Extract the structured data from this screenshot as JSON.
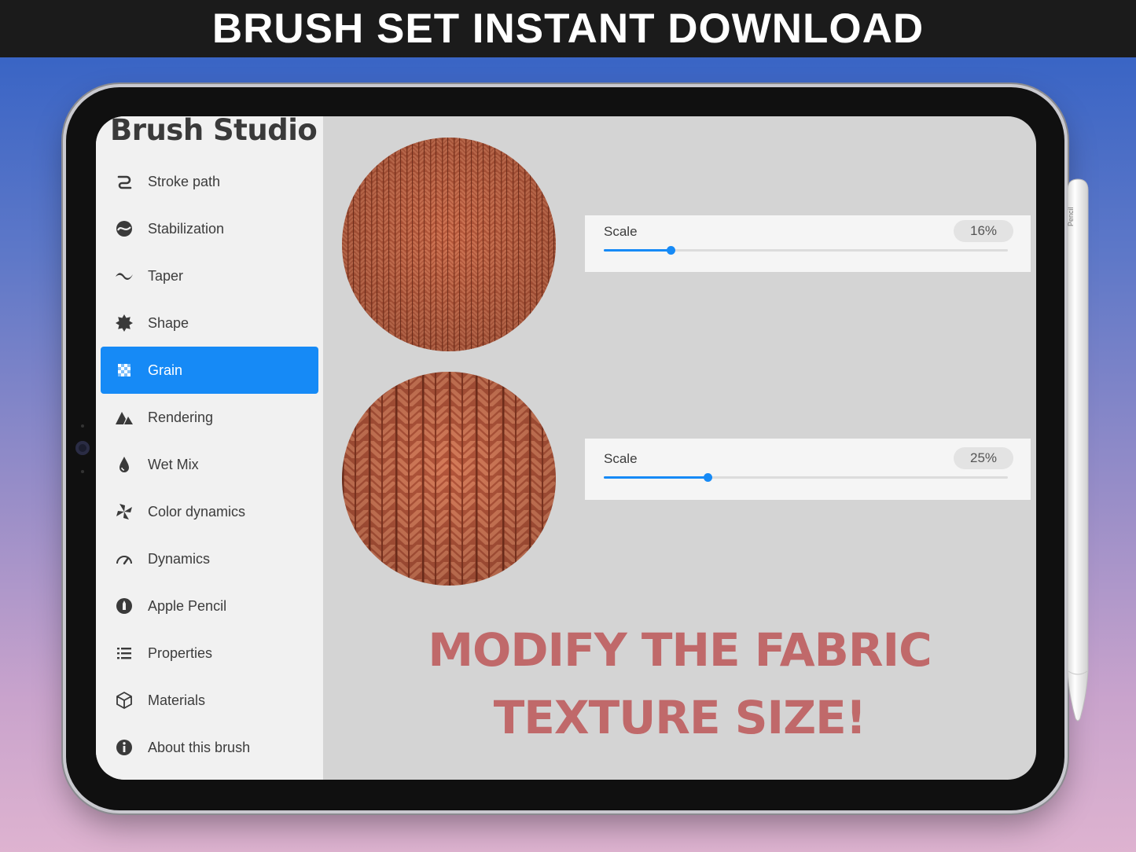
{
  "banner": {
    "text": "BRUSH SET INSTANT DOWNLOAD"
  },
  "sidebar": {
    "title": "Brush Studio",
    "items": [
      {
        "label": "Stroke path",
        "icon": "stroke-path-icon",
        "active": false
      },
      {
        "label": "Stabilization",
        "icon": "stabilization-icon",
        "active": false
      },
      {
        "label": "Taper",
        "icon": "taper-icon",
        "active": false
      },
      {
        "label": "Shape",
        "icon": "shape-icon",
        "active": false
      },
      {
        "label": "Grain",
        "icon": "grain-icon",
        "active": true
      },
      {
        "label": "Rendering",
        "icon": "rendering-icon",
        "active": false
      },
      {
        "label": "Wet Mix",
        "icon": "wet-mix-icon",
        "active": false
      },
      {
        "label": "Color dynamics",
        "icon": "color-dynamics-icon",
        "active": false
      },
      {
        "label": "Dynamics",
        "icon": "dynamics-icon",
        "active": false
      },
      {
        "label": "Apple Pencil",
        "icon": "apple-pencil-icon",
        "active": false
      },
      {
        "label": "Properties",
        "icon": "properties-icon",
        "active": false
      },
      {
        "label": "Materials",
        "icon": "materials-icon",
        "active": false
      },
      {
        "label": "About this brush",
        "icon": "info-icon",
        "active": false
      }
    ]
  },
  "sliders": [
    {
      "label": "Scale",
      "value_text": "16%",
      "fraction": 0.166
    },
    {
      "label": "Scale",
      "value_text": "25%",
      "fraction": 0.257
    }
  ],
  "headline": {
    "line1": "MODIFY THE FABRIC",
    "line2": "TEXTURE SIZE!"
  },
  "pencil": {
    "text": "Pencil"
  },
  "colors": {
    "accent": "#168af6",
    "headline": "#c0696a",
    "texture": "#b85a3c"
  }
}
